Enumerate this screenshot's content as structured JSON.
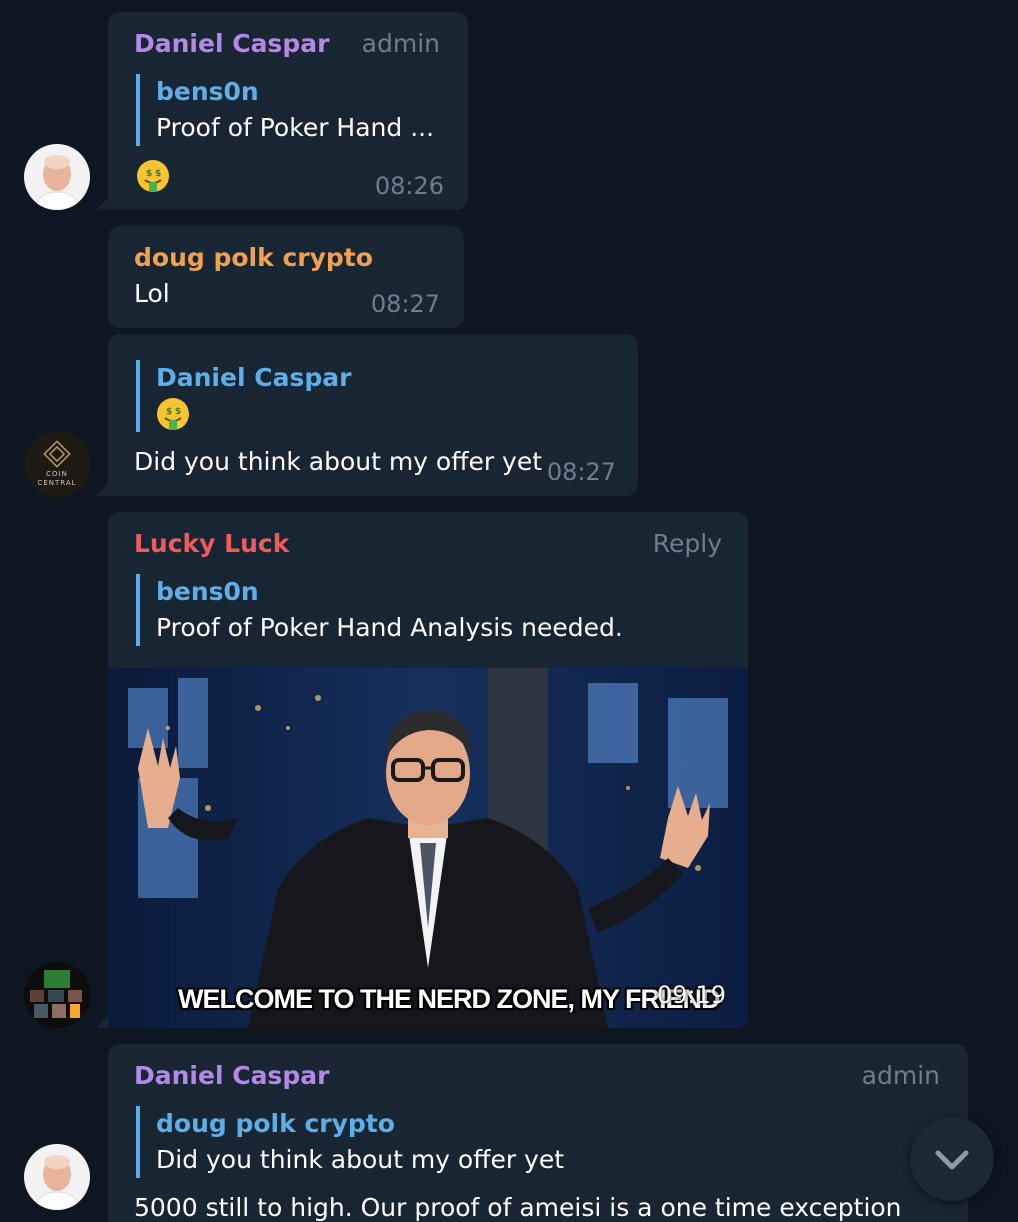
{
  "colors": {
    "background": "#0e1621",
    "bubble": "#182533",
    "quote_accent": "#5eaee8",
    "meta_text": "#6d7f8f",
    "sender_daniel": "#b388e6",
    "sender_doug": "#f0a150",
    "sender_lucky": "#ec5c5c"
  },
  "messages": [
    {
      "sender": "Daniel Caspar",
      "role": "admin",
      "reply_to": {
        "name": "bens0n",
        "text": "Proof of Poker Hand ..."
      },
      "emoji": "money-mouth-face",
      "time": "08:26"
    },
    {
      "sender": "doug polk crypto",
      "text": "Lol",
      "time": "08:27"
    },
    {
      "reply_to": {
        "name": "Daniel Caspar",
        "emoji": "money-mouth-face"
      },
      "text": "Did you think about my offer yet",
      "time": "08:27",
      "avatar_text": {
        "line1": "COIN",
        "line2": "CENTRAL"
      }
    },
    {
      "sender": "Lucky Luck",
      "action": "Reply",
      "reply_to": {
        "name": "bens0n",
        "text": "Proof of Poker Hand Analysis needed."
      },
      "media_caption": "WELCOME TO THE NERD ZONE, MY FRIEND",
      "time": "09:19"
    },
    {
      "sender": "Daniel Caspar",
      "role": "admin",
      "reply_to": {
        "name": "doug polk crypto",
        "text": "Did you think about my offer yet"
      },
      "text": "5000 still to high. Our proof of ameisi is a one time exception"
    }
  ],
  "scroll_button": {
    "icon": "chevron-down-icon"
  }
}
